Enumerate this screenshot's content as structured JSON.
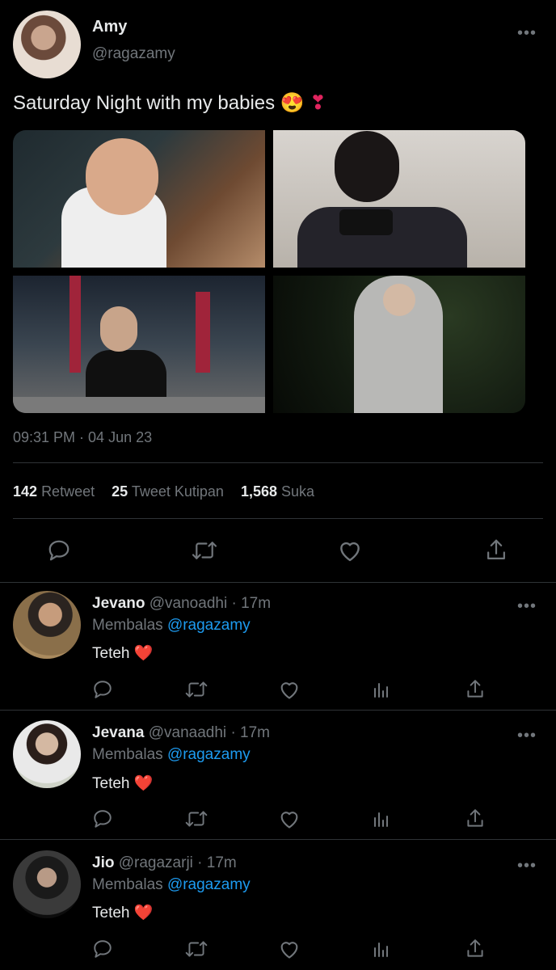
{
  "tweet": {
    "author_name": "Amy",
    "author_handle": "@ragazamy",
    "text": "Saturday Night with my babies",
    "emoji_1": "😍",
    "emoji_2": "❣",
    "timestamp": "09:31 PM · 04 Jun 23",
    "stats": {
      "retweets_count": "142",
      "retweets_label": "Retweet",
      "quotes_count": "25",
      "quotes_label": "Tweet Kutipan",
      "likes_count": "1,568",
      "likes_label": "Suka"
    },
    "more_glyph": "•••"
  },
  "replies": [
    {
      "name": "Jevano",
      "handle": "@vanoadhi",
      "time": "· 17m",
      "replying_prefix": "Membalas",
      "replying_to": "@ragazamy",
      "text": "Teteh",
      "emoji": "❤️"
    },
    {
      "name": "Jevana",
      "handle": "@vanaadhi",
      "time": "· 17m",
      "replying_prefix": "Membalas",
      "replying_to": "@ragazamy",
      "text": "Teteh",
      "emoji": "❤️"
    },
    {
      "name": "Jio",
      "handle": "@ragazarji",
      "time": "· 17m",
      "replying_prefix": "Membalas",
      "replying_to": "@ragazamy",
      "text": "Teteh",
      "emoji": "❤️"
    }
  ],
  "colors": {
    "background": "#000000",
    "text": "#e7e9ea",
    "muted": "#71767b",
    "link": "#1d9bf0",
    "divider": "#2f3336",
    "heart": "#e0245e"
  },
  "icons": [
    "reply-icon",
    "retweet-icon",
    "like-icon",
    "share-icon",
    "views-icon",
    "more-icon"
  ]
}
